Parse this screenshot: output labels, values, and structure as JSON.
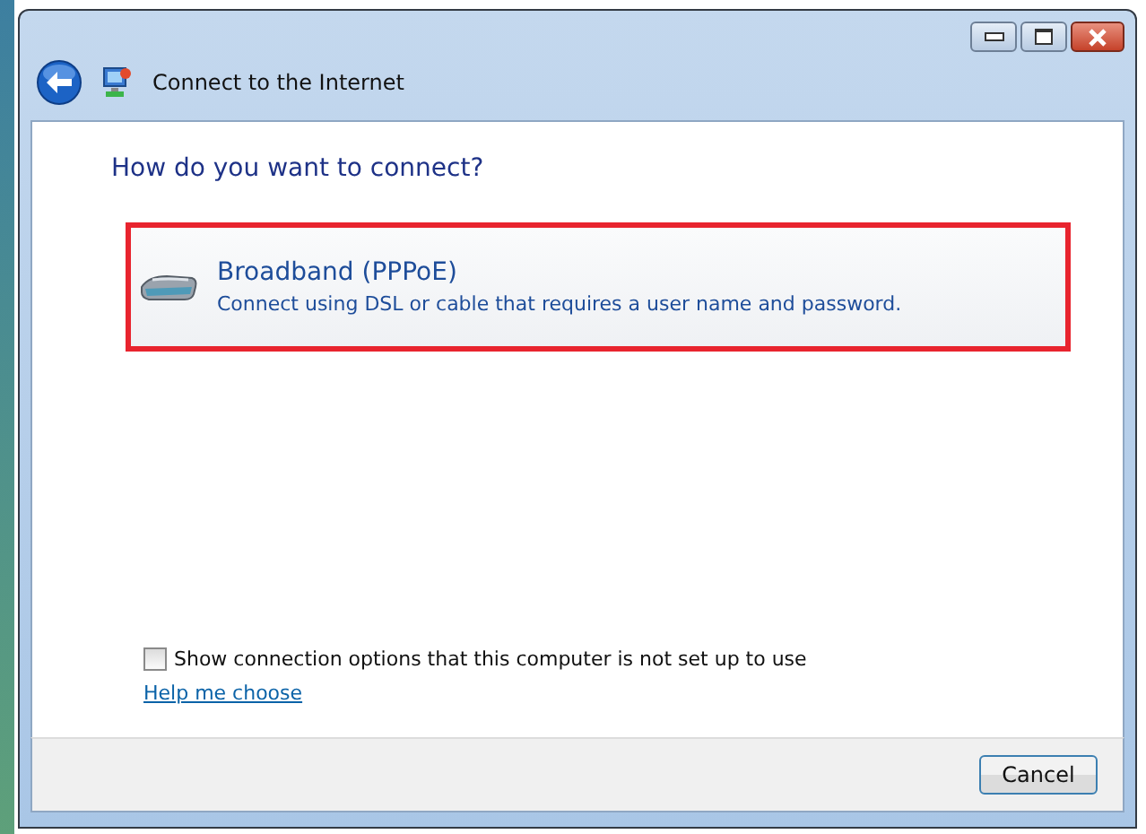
{
  "window": {
    "title": "Connect to the Internet"
  },
  "heading": "How do you want to connect?",
  "options": [
    {
      "title": "Broadband (PPPoE)",
      "description": "Connect using DSL or cable that requires a user name and password.",
      "highlighted": true
    }
  ],
  "show_all_checkbox": {
    "label": "Show connection options that this computer is not set up to use",
    "checked": false
  },
  "help_link": "Help me choose",
  "buttons": [
    "Cancel"
  ]
}
